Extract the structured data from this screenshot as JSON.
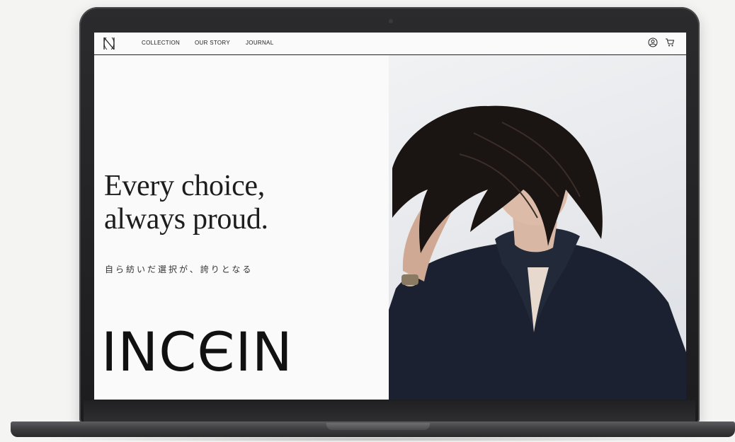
{
  "nav": {
    "logo_icon": "incein-monogram-icon",
    "links": [
      "COLLECTION",
      "OUR STORY",
      "JOURNAL"
    ],
    "account_icon": "account-icon",
    "cart_icon": "cart-icon"
  },
  "hero": {
    "headline_line1": "Every choice,",
    "headline_line2": "always proud.",
    "subtitle": "自ら紡いだ選択が、誇りとなる",
    "wordmark": "INCЄIN"
  },
  "colors": {
    "text": "#1d1d1d",
    "background": "#fafafa",
    "garment": "#1b2130"
  }
}
